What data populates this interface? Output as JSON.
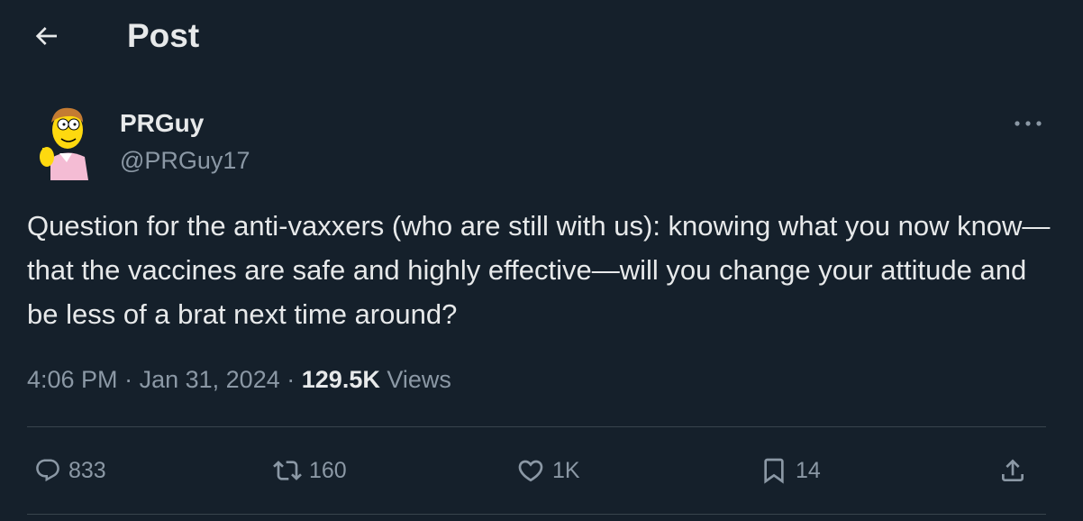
{
  "header": {
    "title": "Post",
    "back_icon": "arrow-left-icon"
  },
  "author": {
    "display_name": "PRGuy",
    "handle": "@PRGuy17",
    "avatar": "cartoon-avatar"
  },
  "post": {
    "text": "Question for the anti-vaxxers (who are still with us): knowing what you now know—that the vaccines are safe and highly effective—will you change your attitude and be less of a brat next time around?",
    "time": "4:06 PM",
    "date": "Jan 31, 2024",
    "separator": "·",
    "views_count": "129.5K",
    "views_label": "Views"
  },
  "actions": {
    "reply_count": "833",
    "repost_count": "160",
    "like_count": "1K",
    "bookmark_count": "14"
  },
  "colors": {
    "background": "#15202b",
    "primary_text": "#e7e9ea",
    "secondary_text": "#8b98a5",
    "divider": "#38444d"
  }
}
